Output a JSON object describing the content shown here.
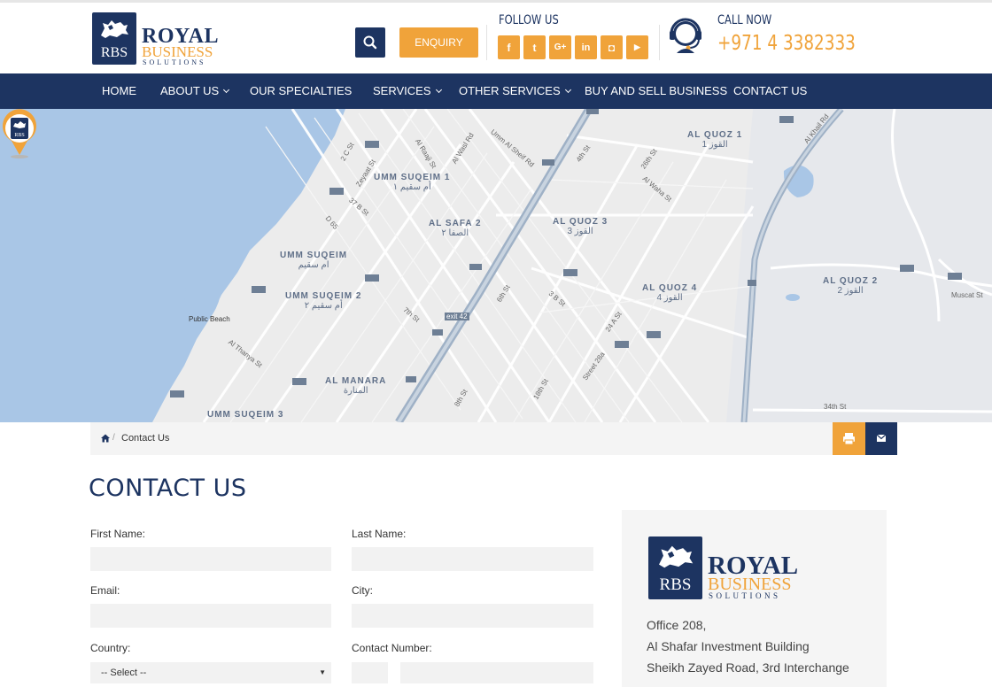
{
  "brand": {
    "badge_text": "RBS",
    "name_line1": "ROYAL",
    "name_line2": "BUSINESS",
    "name_line3": "SOLUTIONS"
  },
  "header": {
    "enquiry_label": "ENQUIRY",
    "follow_label": "FOLLOW US",
    "social_icons": [
      {
        "name": "facebook-icon",
        "glyph": "f"
      },
      {
        "name": "twitter-icon",
        "glyph": "t"
      },
      {
        "name": "google-plus-icon",
        "glyph": "G+"
      },
      {
        "name": "linkedin-icon",
        "glyph": "in"
      },
      {
        "name": "instagram-icon",
        "glyph": "◘"
      },
      {
        "name": "youtube-icon",
        "glyph": "▶"
      }
    ],
    "call_label": "CALL NOW",
    "phone": "+971 4 3382333"
  },
  "nav": {
    "items": [
      {
        "label": "HOME",
        "dropdown": false
      },
      {
        "label": "ABOUT US",
        "dropdown": true
      },
      {
        "label": "OUR SPECIALTIES",
        "dropdown": false
      },
      {
        "label": "SERVICES",
        "dropdown": true
      },
      {
        "label": "OTHER SERVICES",
        "dropdown": true
      },
      {
        "label": "BUY AND SELL BUSINESS",
        "dropdown": false
      },
      {
        "label": "CONTACT US",
        "dropdown": false
      }
    ]
  },
  "map": {
    "areas": [
      {
        "en": "UMM SUQEIM 1",
        "ar": "أم سقيم ١"
      },
      {
        "en": "AL SAFA 2",
        "ar": "الصفا ٢"
      },
      {
        "en": "AL QUOZ 3",
        "ar": "القوز 3"
      },
      {
        "en": "AL QUOZ 1",
        "ar": "القوز 1"
      },
      {
        "en": "UMM SUQEIM",
        "ar": "ام سقيم"
      },
      {
        "en": "UMM SUQEIM 2",
        "ar": "أم سقيم ٢"
      },
      {
        "en": "AL QUOZ 4",
        "ar": "القوز 4"
      },
      {
        "en": "AL QUOZ 2",
        "ar": "القوز 2"
      },
      {
        "en": "AL MANARA",
        "ar": "المنارة"
      },
      {
        "en": "UMM SUQEIM 3",
        "ar": ""
      }
    ],
    "streets": [
      "Public Beach",
      "34th St",
      "Muscat St",
      "Al Khail Rd",
      "Umm Al Sheif Rd",
      "Al Wasl Rd",
      "2 C St",
      "Zeyaat St",
      "D 65",
      "6th St",
      "8th St",
      "18th St",
      "Al Thanya St",
      "Street 28a",
      "exit 42",
      "3 B St",
      "24 A St",
      "26th St",
      "4th St",
      "Al Waha St",
      "Al Raaji St",
      "37 B St",
      "7th St"
    ]
  },
  "breadcrumb": {
    "current": "Contact Us",
    "separator": "/"
  },
  "page": {
    "title": "CONTACT US"
  },
  "form": {
    "first_name_label": "First Name:",
    "last_name_label": "Last Name:",
    "email_label": "Email:",
    "city_label": "City:",
    "country_label": "Country:",
    "contact_number_label": "Contact Number:",
    "country_value": "-- Select --",
    "first_name_value": "",
    "last_name_value": "",
    "email_value": "",
    "city_value": ""
  },
  "address": {
    "line1": "Office 208,",
    "line2": "Al Shafar Investment Building",
    "line3": "Sheikh Zayed Road, 3rd Interchange"
  },
  "colors": {
    "navy": "#1d3461",
    "orange": "#f0a33a",
    "water": "#a9c6e6",
    "land": "#ececec"
  }
}
